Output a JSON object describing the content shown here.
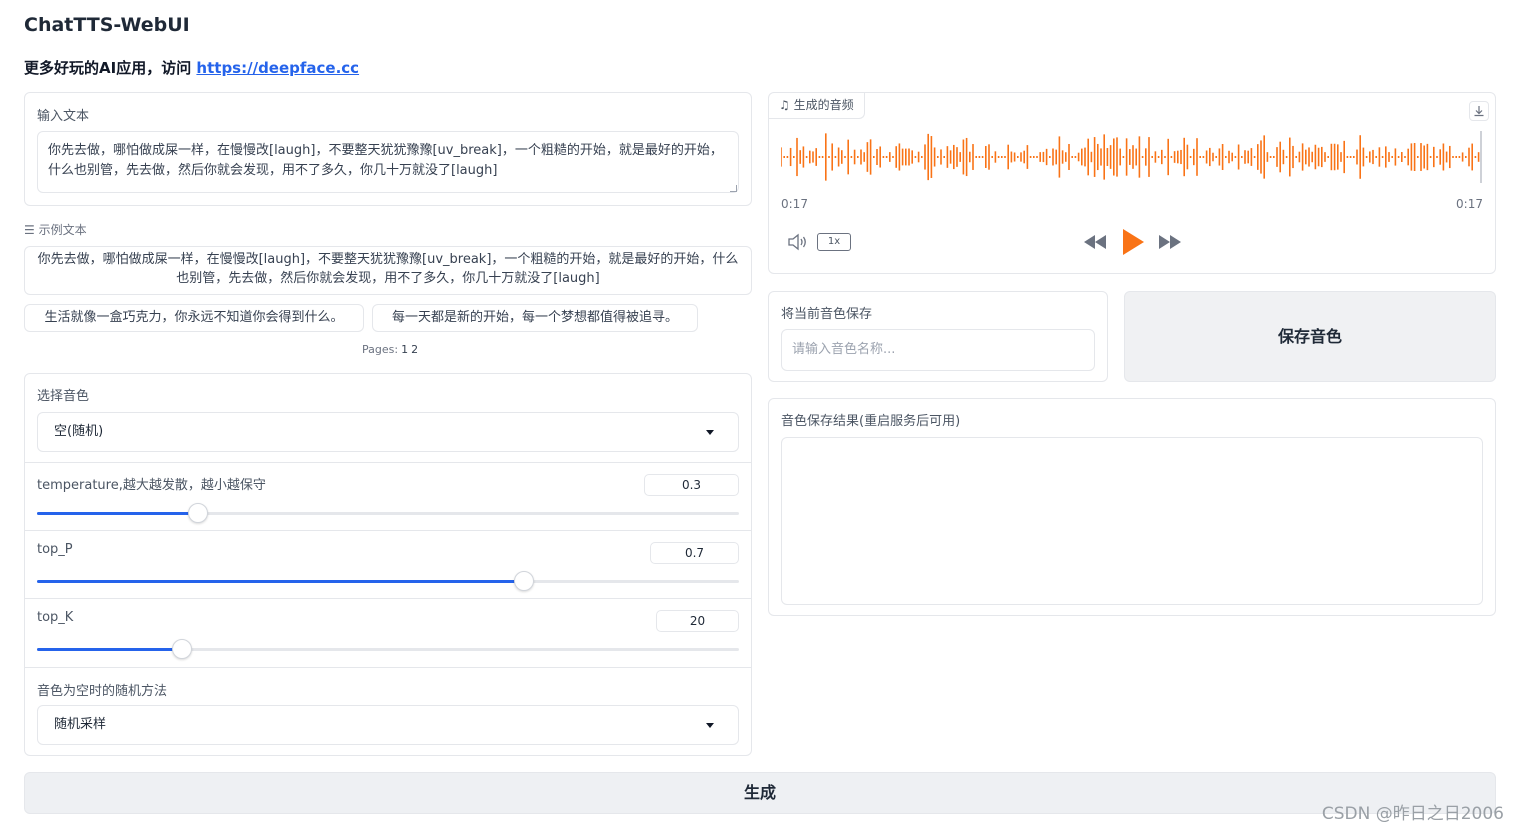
{
  "header": {
    "title": "ChatTTS-WebUI",
    "subtitle_prefix": "更多好玩的AI应用，访问 ",
    "subtitle_link": "https://deepface.cc"
  },
  "input_text": {
    "label": "输入文本",
    "value": "你先去做，哪怕做成屎一样，在慢慢改[laugh]，不要整天犹犹豫豫[uv_break]，一个粗糙的开始，就是最好的开始，什么也别管，先去做，然后你就会发现，用不了多久，你几十万就没了[laugh]"
  },
  "examples": {
    "label": "示例文本",
    "items": [
      "你先去做，哪怕做成屎一样，在慢慢改[laugh]，不要整天犹犹豫豫[uv_break]，一个粗糙的开始，就是最好的开始，什么也别管，先去做，然后你就会发现，用不了多久，你几十万就没了[laugh]",
      "生活就像一盒巧克力，你永远不知道你会得到什么。",
      "每一天都是新的开始，每一个梦想都值得被追寻。"
    ],
    "pages_label": "Pages:",
    "pages": [
      "1",
      "2"
    ]
  },
  "voice": {
    "label": "选择音色",
    "selected": "空(随机)"
  },
  "sliders": {
    "temperature": {
      "label": "temperature,越大越发散，越小越保守",
      "value": "0.3",
      "fraction": 0.23
    },
    "top_p": {
      "label": "top_P",
      "value": "0.7",
      "fraction": 0.694
    },
    "top_k": {
      "label": "top_K",
      "value": "20",
      "fraction": 0.207
    }
  },
  "random_method": {
    "label": "音色为空时的随机方法",
    "selected": "随机采样"
  },
  "audio": {
    "label": "生成的音频",
    "current_time": "0:17",
    "total_time": "0:17",
    "speed": "1x",
    "accent_color": "#f97316"
  },
  "save_voice": {
    "label": "将当前音色保存",
    "placeholder": "请输入音色名称...",
    "button": "保存音色"
  },
  "result": {
    "label": "音色保存结果(重启服务后可用)"
  },
  "generate_button": "生成",
  "watermark": "CSDN @昨日之日2006"
}
